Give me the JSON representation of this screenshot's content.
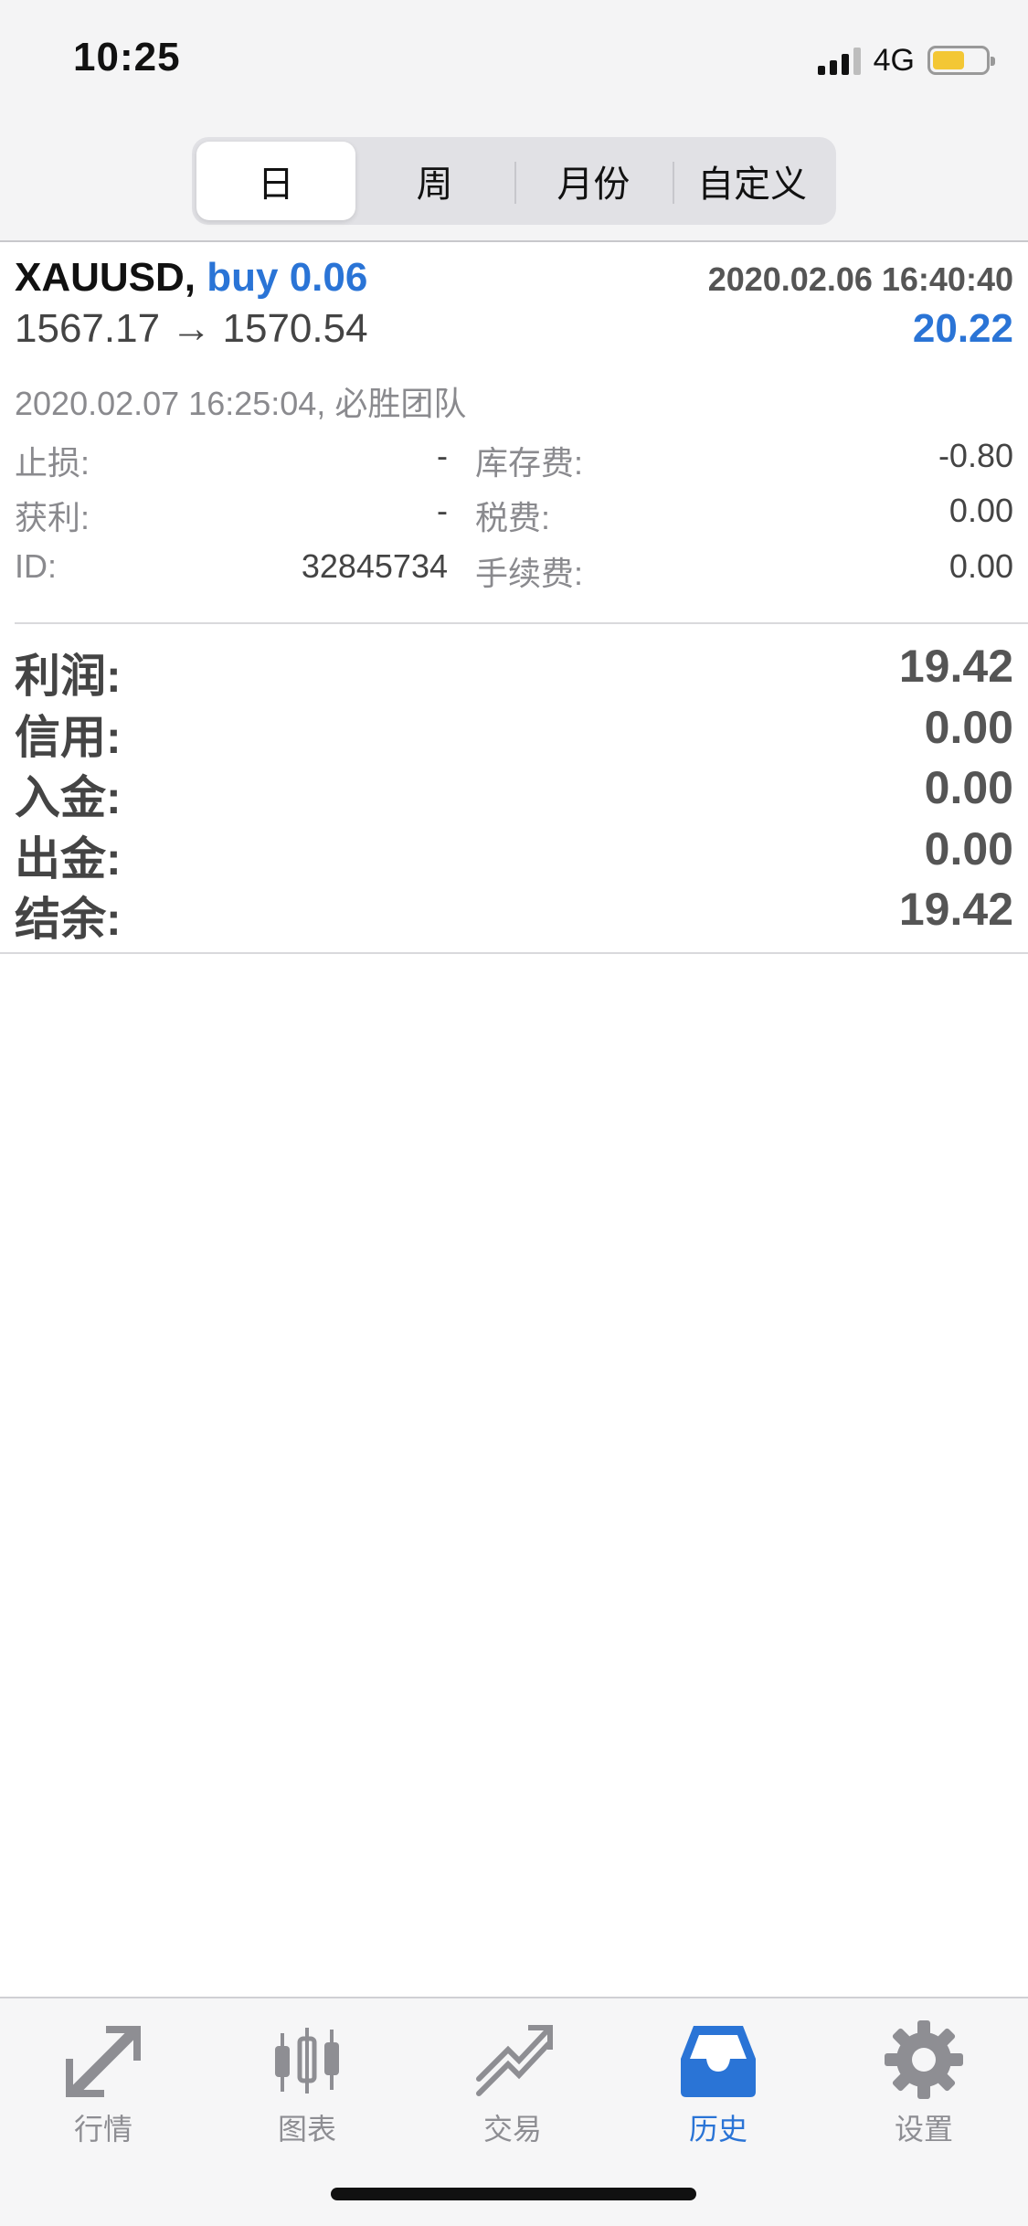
{
  "status_bar": {
    "time": "10:25",
    "network": "4G"
  },
  "period_tabs": [
    {
      "label": "日",
      "active": true
    },
    {
      "label": "周",
      "active": false
    },
    {
      "label": "月份",
      "active": false
    },
    {
      "label": "自定义",
      "active": false
    }
  ],
  "trade": {
    "symbol": "XAUUSD,",
    "side_volume": "buy 0.06",
    "open_time": "2020.02.06 16:40:40",
    "prices": "1567.17 → 1570.54",
    "profit": "20.22",
    "close_info": "2020.02.07 16:25:04, 必胜团队",
    "details": {
      "stop_loss_label": "止损:",
      "stop_loss_value": "-",
      "take_profit_label": "获利:",
      "take_profit_value": "-",
      "id_label": "ID:",
      "id_value": "32845734",
      "swap_label": "库存费:",
      "swap_value": "-0.80",
      "taxes_label": "税费:",
      "taxes_value": "0.00",
      "commission_label": "手续费:",
      "commission_value": "0.00"
    }
  },
  "summary": [
    {
      "label": "利润:",
      "value": "19.42"
    },
    {
      "label": "信用:",
      "value": "0.00"
    },
    {
      "label": "入金:",
      "value": "0.00"
    },
    {
      "label": "出金:",
      "value": "0.00"
    },
    {
      "label": "结余:",
      "value": "19.42"
    }
  ],
  "tabbar": [
    {
      "label": "行情",
      "icon": "quotes-icon",
      "active": false
    },
    {
      "label": "图表",
      "icon": "chart-icon",
      "active": false
    },
    {
      "label": "交易",
      "icon": "trade-icon",
      "active": false
    },
    {
      "label": "历史",
      "icon": "history-icon",
      "active": true
    },
    {
      "label": "设置",
      "icon": "settings-icon",
      "active": false
    }
  ],
  "colors": {
    "accent": "#2a74d6",
    "icon_gray": "#8e8e93"
  }
}
